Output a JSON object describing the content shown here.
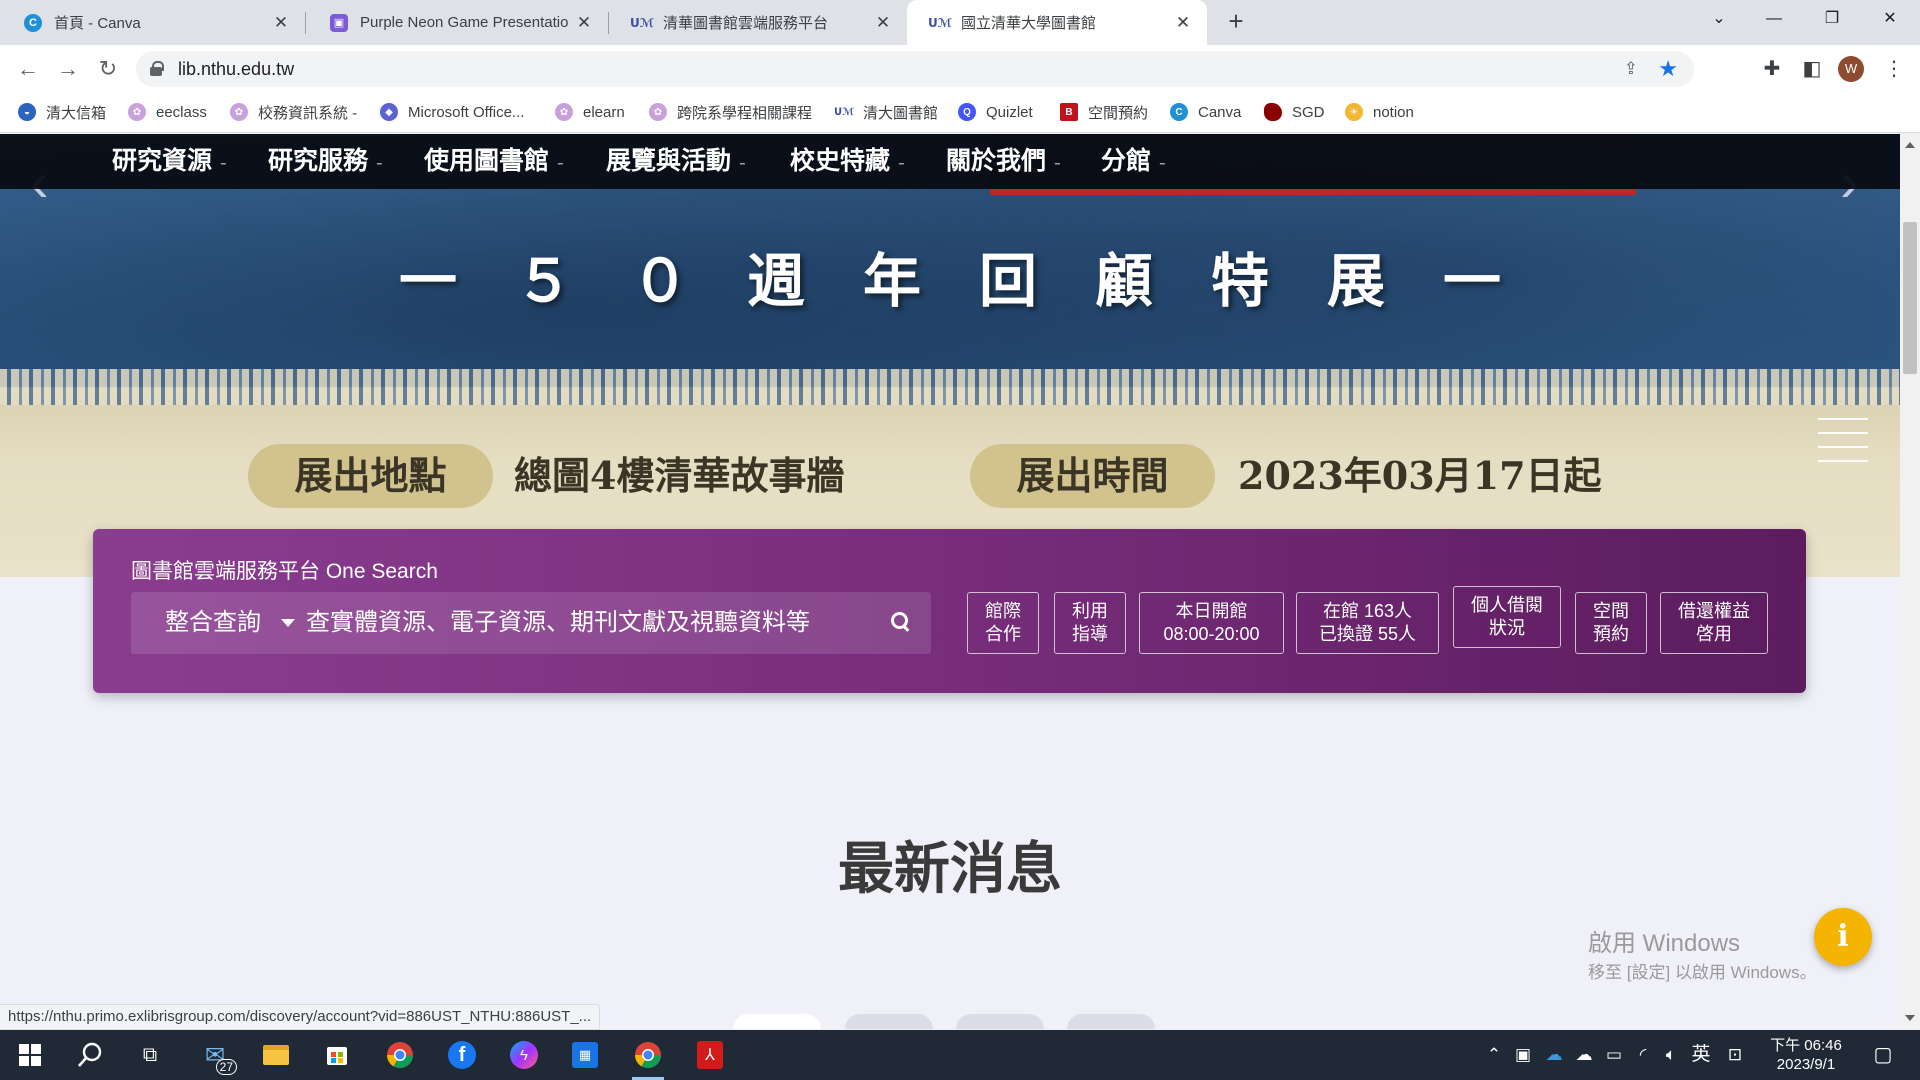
{
  "browser": {
    "tabs": [
      {
        "title": "首頁 - Canva",
        "icon": "canva-icon",
        "color": "#1e90d6",
        "active": false
      },
      {
        "title": "Purple Neon Game Presentatio",
        "icon": "canva-presentation-icon",
        "color": "#7b5cd6",
        "active": false
      },
      {
        "title": "清華圖書館雲端服務平台",
        "icon": "nthu-library-icon",
        "color": "#3b4fa8",
        "active": false
      },
      {
        "title": "國立清華大學圖書館",
        "icon": "nthu-library-icon",
        "color": "#3b4fa8",
        "active": true
      }
    ],
    "url": "lib.nthu.edu.tw",
    "status_url": "https://nthu.primo.exlibrisgroup.com/discovery/account?vid=886UST_NTHU:886UST_...",
    "avatar_letter": "W",
    "bookmarks": [
      {
        "label": "清大信箱",
        "icon": "nthu-mail-icon",
        "color": "#2a64c0"
      },
      {
        "label": "eeclass",
        "icon": "eeclass-icon",
        "color": "#c9a0dc"
      },
      {
        "label": "校務資訊系統 -",
        "icon": "school-system-icon",
        "color": "#c9a0dc"
      },
      {
        "label": "Microsoft Office...",
        "icon": "office-icon",
        "color": "#5b62d6"
      },
      {
        "label": "elearn",
        "icon": "elearn-icon",
        "color": "#c9a0dc"
      },
      {
        "label": "跨院系學程相關課程",
        "icon": "program-icon",
        "color": "#c9a0dc"
      },
      {
        "label": "清大圖書館",
        "icon": "nthu-library-icon",
        "color": "#3b4fa8"
      },
      {
        "label": "Quizlet",
        "icon": "quizlet-icon",
        "color": "#4255ff"
      },
      {
        "label": "空間預約",
        "icon": "space-booking-icon",
        "color": "#c0131c"
      },
      {
        "label": "Canva",
        "icon": "canva-icon",
        "color": "#1e90d6"
      },
      {
        "label": "SGD",
        "icon": "sgd-icon",
        "color": "#8b0000"
      },
      {
        "label": "notion",
        "icon": "notion-icon",
        "color": "#f2b632"
      }
    ]
  },
  "site": {
    "nav": [
      "研究資源",
      "研究服務",
      "使用圖書館",
      "展覽與活動",
      "校史特藏",
      "關於我們",
      "分館"
    ],
    "nav_suffix": "-",
    "hero": {
      "title": "一　５　０　週　年　回　顧　特　展　一",
      "location_label": "展出地點",
      "location_value": "總圖4樓清華故事牆",
      "time_label": "展出時間",
      "time_value": "2023年03月17日起"
    },
    "search": {
      "label": "圖書館雲端服務平台 One Search",
      "scope": "整合查詢",
      "placeholder": "查實體資源、電子資源、期刊文獻及視聽資料等",
      "quick_buttons": [
        "館際\n合作",
        "利用\n指導",
        "本日開館\n08:00-20:00",
        "在館 163人\n已換證 55人",
        "個人借閱\n狀況",
        "空間\n預約",
        "借還權益\n啓用"
      ]
    },
    "news_title": "最新消息",
    "info_icon": "i"
  },
  "overlay": {
    "windows_activate_title": "啟用 Windows",
    "windows_activate_sub": "移至 [設定] 以啟用 Windows。"
  },
  "taskbar": {
    "mail_badge": "27",
    "ime": "英",
    "clock_time": "下午 06:46",
    "clock_date": "2023/9/1"
  }
}
